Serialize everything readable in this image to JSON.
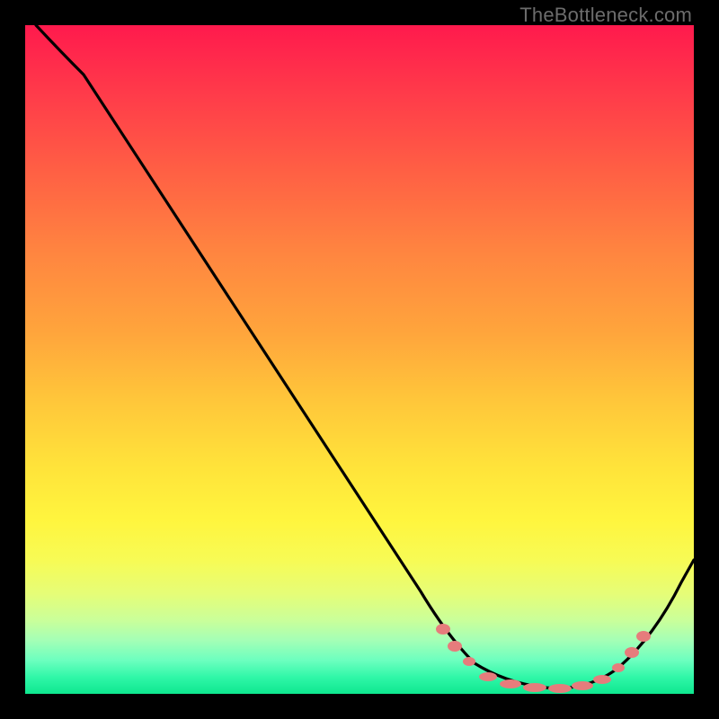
{
  "watermark": "TheBottleneck.com",
  "chart_data": {
    "type": "line",
    "title": "",
    "xlabel": "",
    "ylabel": "",
    "xlim": [
      0,
      100
    ],
    "ylim": [
      0,
      100
    ],
    "note": "Axes unlabeled. Background is a vertical red→yellow→green gradient (red=high bottleneck, green=optimal). Black curve is bottleneck % vs component performance; flat valley marks the optimal range.",
    "series": [
      {
        "name": "bottleneck-curve",
        "x": [
          0,
          5,
          12,
          58,
          63,
          70,
          80,
          86,
          90,
          95,
          100
        ],
        "values": [
          100,
          98,
          93,
          15,
          8,
          3,
          1,
          1,
          3,
          10,
          18
        ]
      }
    ],
    "markers": {
      "name": "optimal-range-dots",
      "color": "#e67c7c",
      "points_x": [
        63,
        64,
        67,
        70,
        73,
        76,
        79,
        82,
        85,
        87,
        88,
        89
      ]
    }
  }
}
